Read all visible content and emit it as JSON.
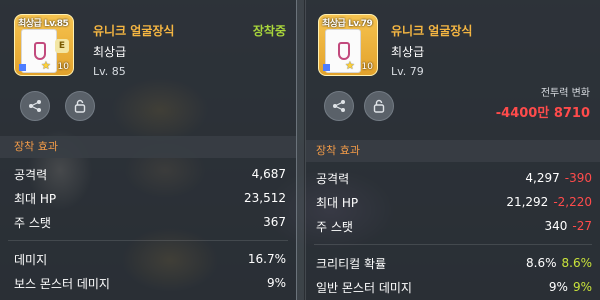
{
  "left": {
    "icon_label": "최상급 Lv.85",
    "icon_badge": "E",
    "icon_count": "10",
    "name": "유니크 얼굴장식",
    "status": "장착중",
    "grade": "최상급",
    "level": "Lv. 85",
    "section": "장착 효과",
    "stats": [
      {
        "label": "공격력",
        "value": "4,687"
      },
      {
        "label": "최대 HP",
        "value": "23,512"
      },
      {
        "label": "주 스탯",
        "value": "367"
      },
      {
        "label": "데미지",
        "value": "16.7%"
      },
      {
        "label": "보스 몬스터 데미지",
        "value": "9%"
      }
    ]
  },
  "right": {
    "icon_label": "최상급 Lv.79",
    "icon_count": "10",
    "name": "유니크 얼굴장식",
    "grade": "최상급",
    "level": "Lv. 79",
    "power_label": "전투력 변화",
    "power_value": "-4400만 8710",
    "section": "장착 효과",
    "stats": [
      {
        "label": "공격력",
        "value": "4,297",
        "diff": "-390",
        "diff_type": "neg"
      },
      {
        "label": "최대 HP",
        "value": "21,292",
        "diff": "-2,220",
        "diff_type": "neg"
      },
      {
        "label": "주 스탯",
        "value": "340",
        "diff": "-27",
        "diff_type": "neg"
      },
      {
        "label": "크리티컬 확률",
        "value": "8.6%",
        "diff": "8.6%",
        "diff_type": "pos"
      },
      {
        "label": "일반 몬스터 데미지",
        "value": "9%",
        "diff": "9%",
        "diff_type": "pos"
      }
    ]
  },
  "icons": {
    "share": "share-icon",
    "lock": "lock-icon"
  },
  "colors": {
    "item_name": "#f5b642",
    "equipped": "#a9d63b",
    "section_title": "#f09a48",
    "negative": "#ff4b4b",
    "positive": "#c9e33a"
  }
}
